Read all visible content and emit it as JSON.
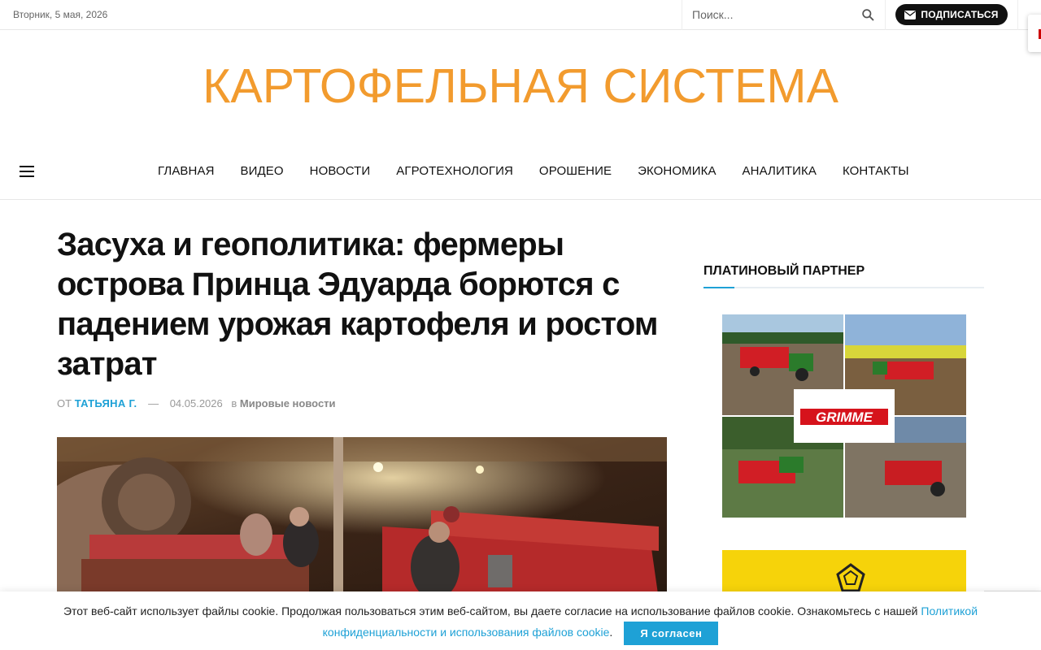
{
  "topbar": {
    "date": "Вторник, 5 мая, 2026",
    "search_placeholder": "Поиск...",
    "subscribe_label": "ПОДПИСАТЬСЯ"
  },
  "site": {
    "logo_text": "КАРТОФЕЛЬНАЯ СИСТЕМА"
  },
  "nav": {
    "items": [
      "ГЛАВНАЯ",
      "ВИДЕО",
      "НОВОСТИ",
      "АГРОТЕХНОЛОГИЯ",
      "ОРОШЕНИЕ",
      "ЭКОНОМИКА",
      "АНАЛИТИКА",
      "КОНТАКТЫ"
    ]
  },
  "article": {
    "title": "Засуха и геополитика: фермеры острова Принца Эдуарда борются с падением урожая картофеля и ростом затрат",
    "by_label": "ОТ",
    "author": "ТАТЬЯНА Г.",
    "dash": "—",
    "date": "04.05.2026",
    "in_label": "в",
    "category": "Мировые новости"
  },
  "sidebar": {
    "partner_title": "ПЛАТИНОВЫЙ ПАРТНЕР",
    "partner_logo_text": "GRIMME"
  },
  "cookie": {
    "text": "Этот веб-сайт использует файлы cookie. Продолжая пользоваться этим веб-сайтом, вы даете согласие на использование файлов cookie. Ознакомьтесь с нашей ",
    "link": "Политикой конфиденциальности и использования файлов cookie",
    "period": ".",
    "agree_label": "Я согласен"
  },
  "colors": {
    "accent": "#1ea1d6",
    "logo": "#f29b2e",
    "grimme_red": "#d6131c"
  }
}
